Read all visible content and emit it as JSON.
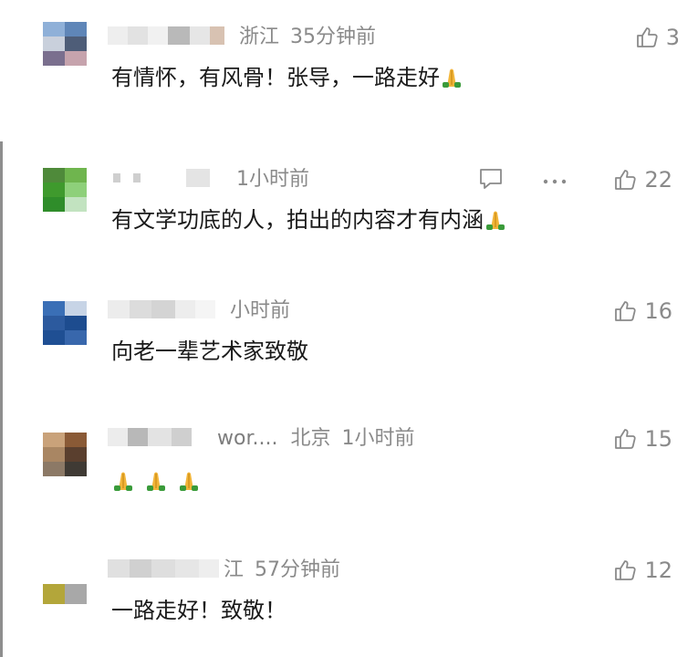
{
  "comments": [
    {
      "location": "浙江",
      "time": "35分钟前",
      "text": "有情怀，有风骨！张导，一路走好",
      "emoji_count": 1,
      "likes": "3",
      "has_actions": false
    },
    {
      "location": "",
      "time": "1小时前",
      "text": "有文学功底的人，拍出的内容才有内涵",
      "emoji_count": 1,
      "likes": "22",
      "has_actions": true
    },
    {
      "location": "",
      "time": "小时前",
      "text": "向老一辈艺术家致敬",
      "emoji_count": 0,
      "likes": "16",
      "has_actions": false
    },
    {
      "name_visible": "wor....",
      "location": "北京",
      "time": "1小时前",
      "text": "",
      "emoji_count": 3,
      "likes": "15",
      "has_actions": false
    },
    {
      "location": "江",
      "time": "57分钟前",
      "text": "一路走好！致敬！",
      "emoji_count": 0,
      "likes": "12",
      "has_actions": false
    }
  ],
  "icons": {
    "like": "thumbs-up-icon",
    "reply": "comment-bubble-icon",
    "more": "more-dots-icon",
    "emoji": "folded-hands-emoji"
  },
  "colors": {
    "meta_gray": "#8a8a8a",
    "text_dark": "#1a1a1a",
    "left_rule": "#8e8e8e"
  }
}
